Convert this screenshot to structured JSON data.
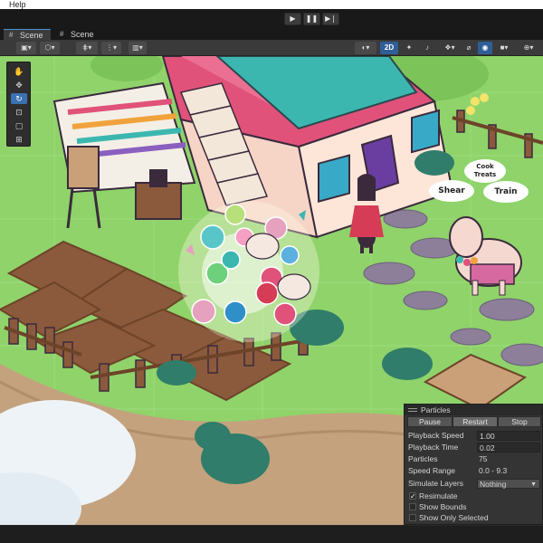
{
  "menubar": {
    "help": "Help"
  },
  "playbar": {
    "play": "▶",
    "pause": "❚❚",
    "step": "▶❘"
  },
  "tabs": [
    {
      "label": "Scene",
      "icon": "scene-icon"
    },
    {
      "label": "Scene",
      "icon": "scene-icon"
    }
  ],
  "toolbar": {
    "mode_2d": "2D",
    "icons": [
      "draw-mode-icon",
      "pivot-icon",
      "grid-snap-icon",
      "increment-snap-icon",
      "shading-icon",
      "audio-icon",
      "effects-icon",
      "visibility-icon",
      "camera-icon",
      "gizmos-icon"
    ]
  },
  "tools": [
    "hand-tool-icon",
    "move-tool-icon",
    "rotate-tool-icon",
    "scale-tool-icon",
    "rect-tool-icon",
    "transform-tool-icon"
  ],
  "bubbles": {
    "cook_treats": "Cook\nTreats",
    "shear": "Shear",
    "train": "Train"
  },
  "particles_panel": {
    "title": "Particles",
    "buttons": {
      "pause": "Pause",
      "restart": "Restart",
      "stop": "Stop"
    },
    "rows": [
      {
        "label": "Playback Speed",
        "value": "1.00"
      },
      {
        "label": "Playback Time",
        "value": "0.02"
      },
      {
        "label": "Particles",
        "value": "75"
      },
      {
        "label": "Speed Range",
        "value": "0.0 - 9.3"
      },
      {
        "label": "Simulate Layers",
        "value": "Nothing"
      }
    ],
    "checkboxes": [
      {
        "label": "Resimulate",
        "checked": true
      },
      {
        "label": "Show Bounds",
        "checked": false
      },
      {
        "label": "Show Only Selected",
        "checked": false
      }
    ]
  },
  "colors": {
    "accent": "#2f5f97",
    "grass": "#8fd36a",
    "wall": "#fde6d8",
    "roof": "#e0527a",
    "panel": "#343434"
  }
}
